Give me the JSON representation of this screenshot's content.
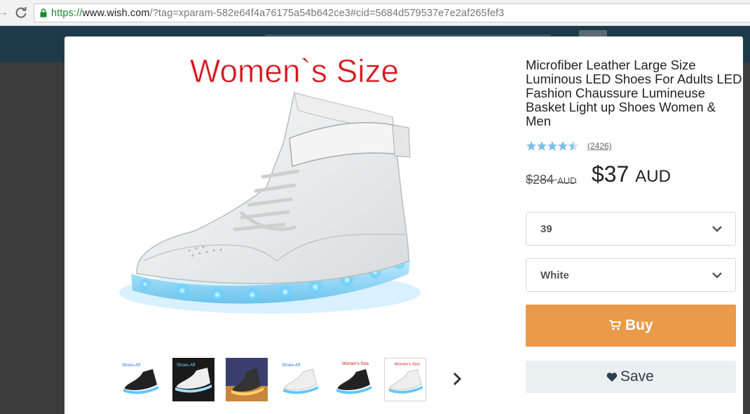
{
  "browser": {
    "url_scheme": "https://",
    "url_host": "www.wish.com",
    "url_rest": "/?tag=xparam-582e64f4a76175a54b642ce3#cid=5684d579537e7e2af265fef3"
  },
  "product": {
    "image_banner": "Women`s Size",
    "title": "Microfiber Leather Large Size Luminous LED Shoes For Adults LED Fashion Chaussure Lumineuse Basket Light up Shoes Women & Men",
    "rating": 4.5,
    "review_count": "(2426)",
    "old_price": "$284",
    "old_price_currency": "AUD",
    "price": "$37",
    "price_currency": "AUD",
    "size_value": "39",
    "color_value": "White",
    "buy_label": "Buy",
    "save_label": "Save",
    "thumbnails": [
      {
        "caption": "Shoes-Aff",
        "style": "black"
      },
      {
        "caption": "Shoes-Aff",
        "style": "white-dark"
      },
      {
        "caption": "",
        "style": "night"
      },
      {
        "caption": "Shoes-Aff",
        "style": "white"
      },
      {
        "caption": "Women's Size",
        "style": "black-red"
      },
      {
        "caption": "Women's Size",
        "style": "white-red"
      }
    ]
  },
  "colors": {
    "buy": "#ea9a49",
    "save_bg": "#eaeff2",
    "star": "#7bbde6",
    "url_green": "#1a8a2e",
    "led_blue": "#5ec8ff"
  }
}
